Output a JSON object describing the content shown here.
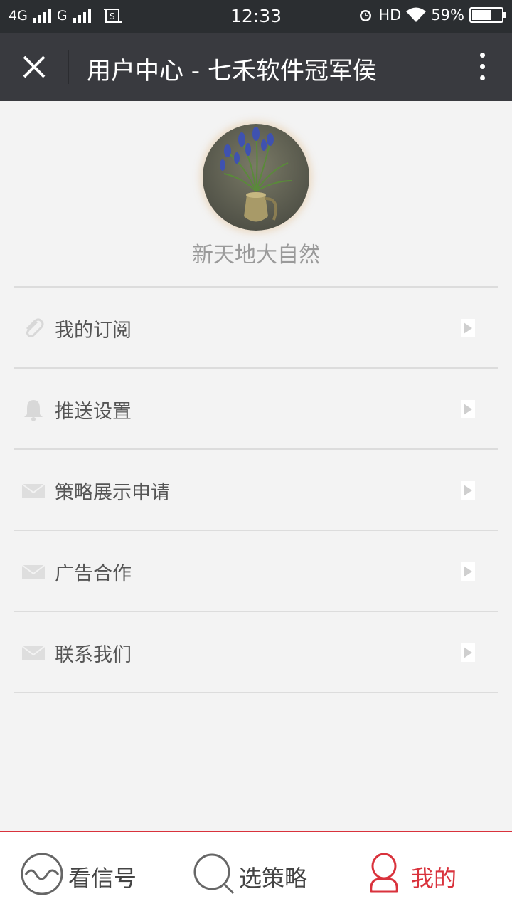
{
  "status_bar": {
    "network1": "4G",
    "network2": "G",
    "time": "12:33",
    "hd": "HD",
    "battery": "59%"
  },
  "header": {
    "title": "用户中心 - 七禾软件冠军侯"
  },
  "profile": {
    "username": "新天地大自然"
  },
  "menu": {
    "items": [
      {
        "label": "我的订阅",
        "icon": "paperclip-icon"
      },
      {
        "label": "推送设置",
        "icon": "bell-icon"
      },
      {
        "label": "策略展示申请",
        "icon": "envelope-icon"
      },
      {
        "label": "广告合作",
        "icon": "envelope-icon"
      },
      {
        "label": "联系我们",
        "icon": "envelope-icon"
      }
    ]
  },
  "tabs": [
    {
      "label": "看信号",
      "icon": "wave-circle-icon",
      "active": false
    },
    {
      "label": "选策略",
      "icon": "search-icon",
      "active": false
    },
    {
      "label": "我的",
      "icon": "user-icon",
      "active": true
    }
  ],
  "colors": {
    "accent": "#d9323c",
    "title_bar": "#393a3f",
    "status_bar": "#2b2e31",
    "background": "#f3f3f3"
  }
}
